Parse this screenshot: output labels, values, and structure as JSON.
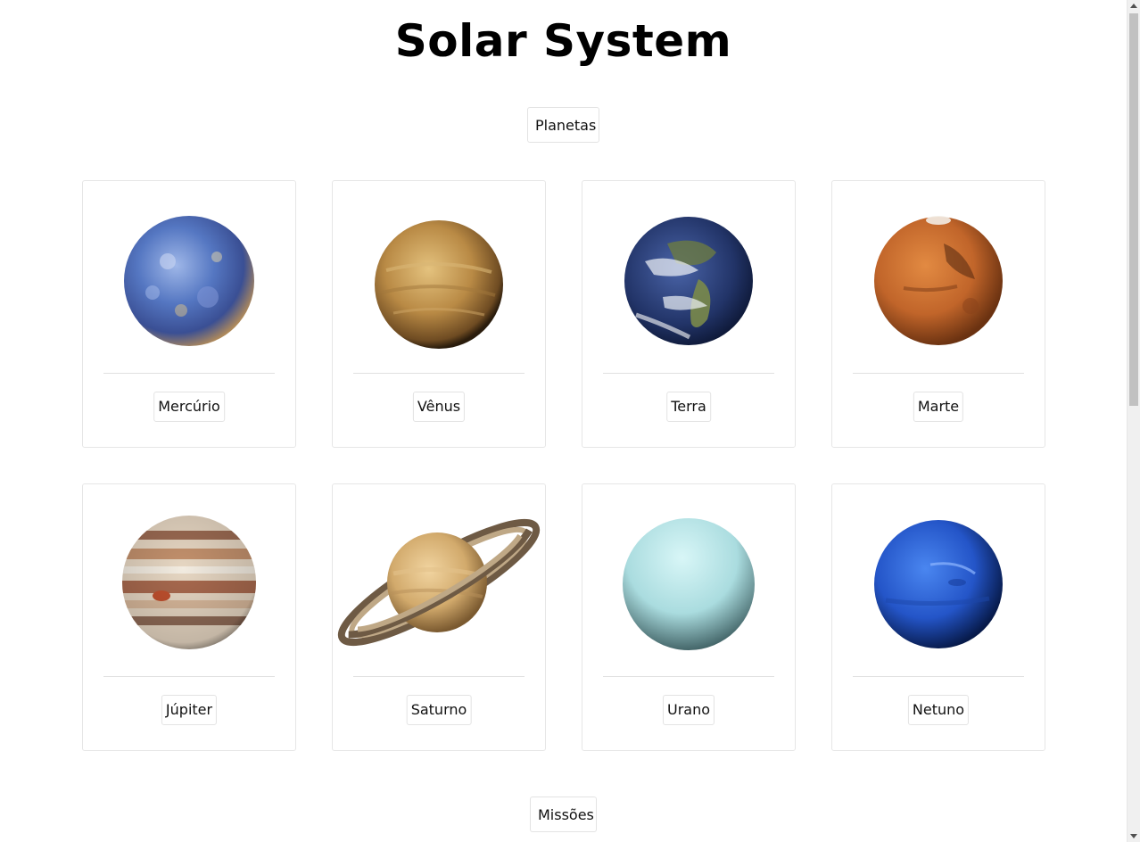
{
  "page": {
    "title": "Solar System"
  },
  "sections": {
    "planets_label": "Planetas",
    "missions_label": "Missões"
  },
  "planets": [
    {
      "name": "Mercúrio",
      "icon": "mercury-icon"
    },
    {
      "name": "Vênus",
      "icon": "venus-icon"
    },
    {
      "name": "Terra",
      "icon": "earth-icon"
    },
    {
      "name": "Marte",
      "icon": "mars-icon"
    },
    {
      "name": "Júpiter",
      "icon": "jupiter-icon"
    },
    {
      "name": "Saturno",
      "icon": "saturn-icon"
    },
    {
      "name": "Urano",
      "icon": "uranus-icon"
    },
    {
      "name": "Netuno",
      "icon": "neptune-icon"
    }
  ],
  "colors": {
    "mercury": "#5b7fc7",
    "venus": "#b8884a",
    "earth": "#2a3f78",
    "mars": "#c8692a",
    "jupiter": "#c7a98a",
    "saturn": "#d8b27a",
    "uranus": "#b7e3e6",
    "neptune": "#2c5bd4"
  }
}
